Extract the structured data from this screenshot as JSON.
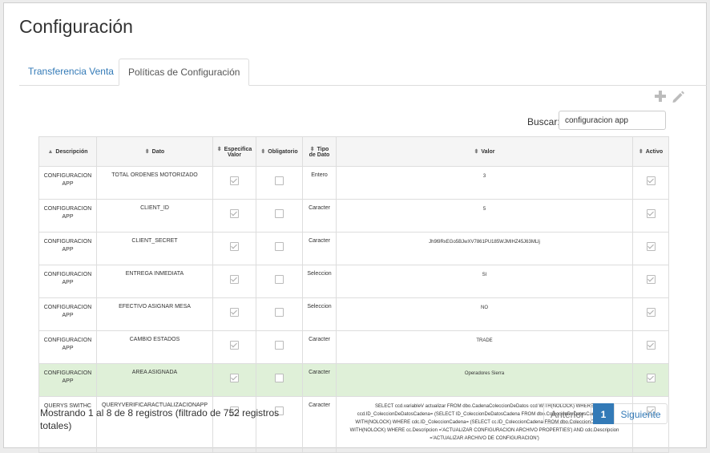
{
  "page": {
    "title": "Configuración"
  },
  "tabs": [
    {
      "label": "Transferencia Venta",
      "active": false
    },
    {
      "label": "Políticas de Configuración",
      "active": true
    }
  ],
  "toolbar": {
    "add_icon": "plus-icon",
    "edit_icon": "pencil-icon"
  },
  "search": {
    "label": "Buscar:",
    "value": "configuracion app"
  },
  "table": {
    "headers": {
      "descripcion": "Descripción",
      "dato": "Dato",
      "especifica_valor_1": "Especifica",
      "especifica_valor_2": "Valor",
      "obligatorio": "Obligatorio",
      "tipo_dato_1": "Tipo",
      "tipo_dato_2": "de Dato",
      "valor": "Valor",
      "activo": "Activo"
    },
    "rows": [
      {
        "desc1": "CONFIGURACION",
        "desc2": "APP",
        "dato": "TOTAL ORDENES MOTORIZADO",
        "especifica": true,
        "obligatorio": false,
        "tipo": "Entero",
        "valor": "3",
        "activo": true
      },
      {
        "desc1": "CONFIGURACION",
        "desc2": "APP",
        "dato": "CLIENT_ID",
        "especifica": true,
        "obligatorio": false,
        "tipo": "Caracter",
        "valor": "5",
        "activo": true
      },
      {
        "desc1": "CONFIGURACION",
        "desc2": "APP",
        "dato": "CLIENT_SECRET",
        "especifica": true,
        "obligatorio": false,
        "tipo": "Caracter",
        "valor": "Jh9l9RxEGo5BJwXV7861PU185WJMIHZ45J63MLlj",
        "activo": true
      },
      {
        "desc1": "CONFIGURACION",
        "desc2": "APP",
        "dato": "ENTREGA INMEDIATA",
        "especifica": true,
        "obligatorio": false,
        "tipo": "Seleccion",
        "valor": "SI",
        "activo": true
      },
      {
        "desc1": "CONFIGURACION",
        "desc2": "APP",
        "dato": "EFECTIVO ASIGNAR MESA",
        "especifica": true,
        "obligatorio": false,
        "tipo": "Seleccion",
        "valor": "NO",
        "activo": true
      },
      {
        "desc1": "CONFIGURACION",
        "desc2": "APP",
        "dato": "CAMBIO ESTADOS",
        "especifica": true,
        "obligatorio": false,
        "tipo": "Caracter",
        "valor": "TRADE",
        "activo": true
      },
      {
        "desc1": "CONFIGURACION",
        "desc2": "APP",
        "dato": "AREA ASIGNADA",
        "especifica": true,
        "obligatorio": false,
        "tipo": "Caracter",
        "valor": "Operadores Sierra",
        "activo": true,
        "highlighted": true
      },
      {
        "desc1": "QUERYS SWITHC",
        "desc2": "",
        "dato": "QUERYVERIFICARACTUALIZACIONAPP",
        "especifica": true,
        "obligatorio": false,
        "tipo": "Caracter",
        "valor": "SELECT ccd.variableV actualizar FROM dbo.CadenaColeccionDeDatos ccd WITH(NOLOCK) WHERE ccd.ID_ColeccionDeDatosCadena= (SELECT ID_ColeccionDeDatosCadena FROM dbo.ColeccionDeDatosCadena cdc WITH(NOLOCK) WHERE cdc.ID_ColeccionCadena= (SELECT cc.ID_ColeccionCadena FROM dbo.ColeccionCadena cc WITH(NOLOCK) WHERE cc.Descripcion ='ACTUALIZAR CONFIGURACION ARCHIVO PROPERTIES') AND cdc.Descripcion ='ACTUALIZAR ARCHIVO DE CONFIGURACION')",
        "activo": true
      }
    ]
  },
  "footer": {
    "status": "Mostrando 1 al 8 de 8 registros (filtrado de 752 registros totales)",
    "prev": "Anterior",
    "page": "1",
    "next": "Siguiente"
  },
  "colors": {
    "accent": "#337ab7",
    "highlight_row": "#dff0d8"
  }
}
